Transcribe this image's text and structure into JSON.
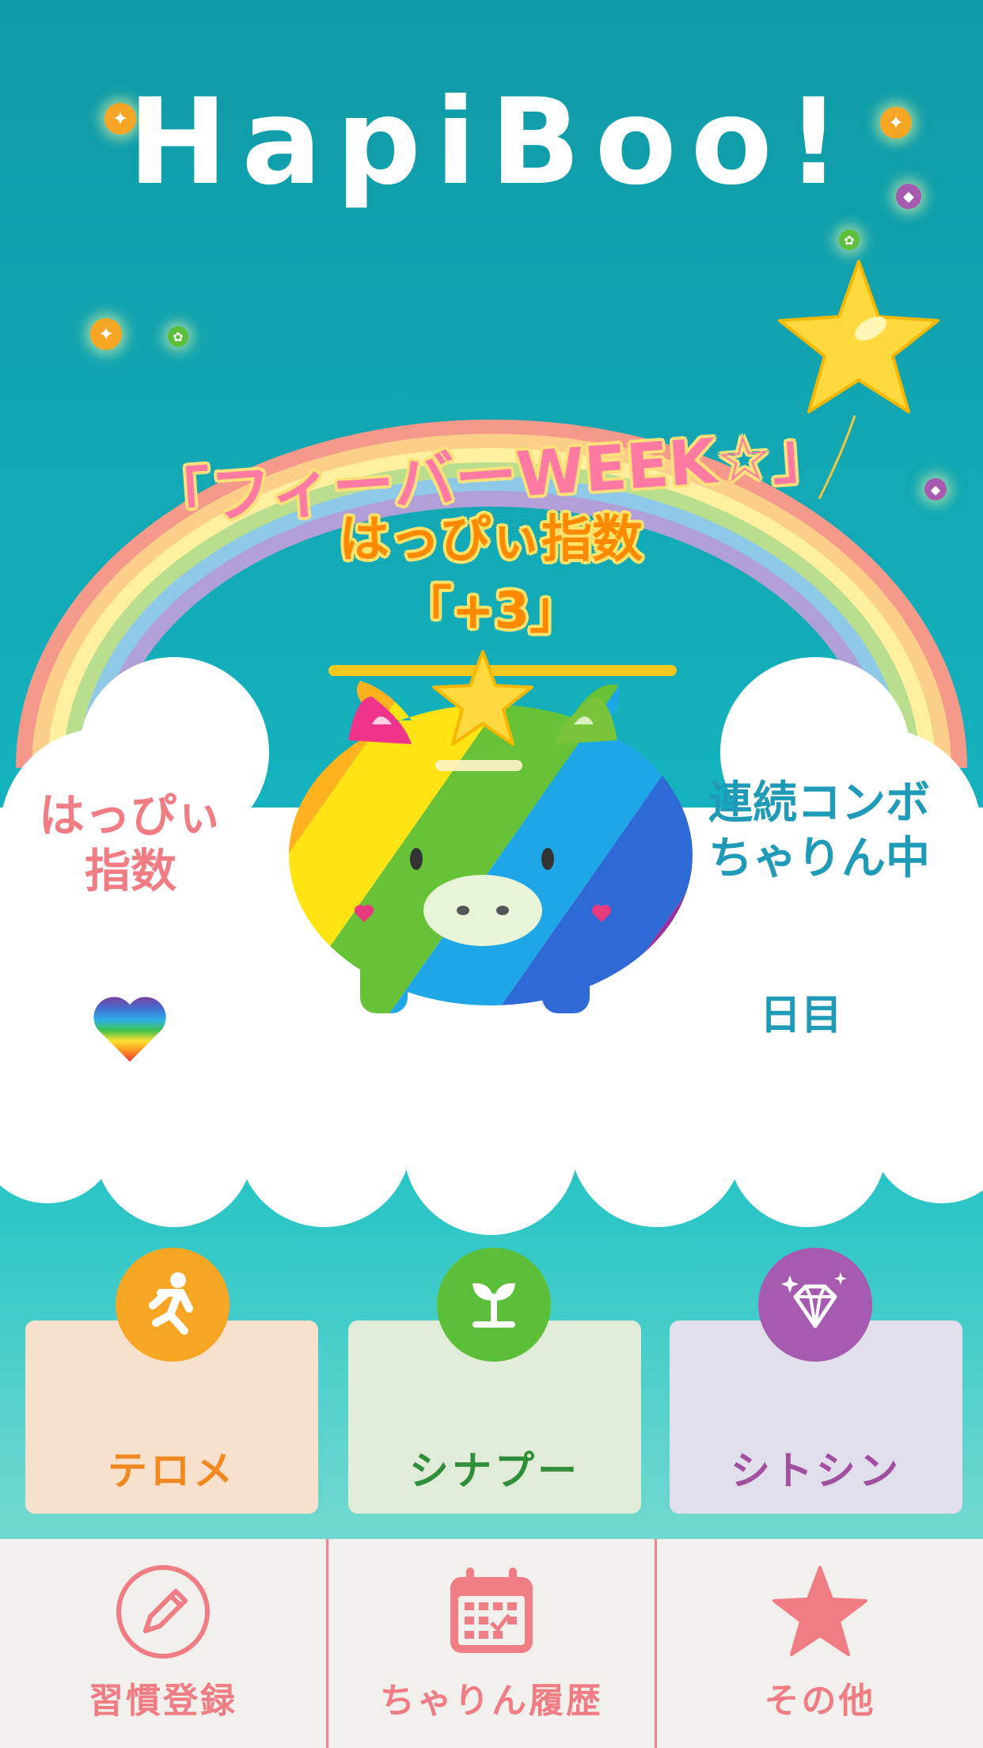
{
  "app": {
    "logo": "HapiBoo!"
  },
  "banner": {
    "line1": "「フィーバーWEEK☆」",
    "line2": "はっぴぃ指数",
    "line3": "「+3」"
  },
  "left_panel": {
    "line1": "はっぴぃ",
    "line2": "指数"
  },
  "right_panel": {
    "line1": "連続コンボ",
    "line2": "ちゃりん中",
    "days_suffix": "日目"
  },
  "categories": [
    {
      "label": "テロメ",
      "icon": "running-person-icon",
      "bg": "#f8e1cc",
      "circle": "#f6a623",
      "text": "#f08a20"
    },
    {
      "label": "シナプー",
      "icon": "sprout-icon",
      "bg": "#e1ecd8",
      "circle": "#5cbf3a",
      "text": "#2e8e3a"
    },
    {
      "label": "シトシン",
      "icon": "diamond-icon",
      "bg": "#e2dfec",
      "circle": "#a65ab0",
      "text": "#a0509e"
    }
  ],
  "nav": [
    {
      "label": "習慣登録",
      "icon": "pencil-icon"
    },
    {
      "label": "ちゃりん履歴",
      "icon": "calendar-icon"
    },
    {
      "label": "その他",
      "icon": "star-icon"
    }
  ],
  "colors": {
    "accent_pink": "#f07c84",
    "teal_text": "#1f9bb8",
    "banner_pink": "#ff7aa3",
    "banner_yellow": "#ffe07a"
  }
}
